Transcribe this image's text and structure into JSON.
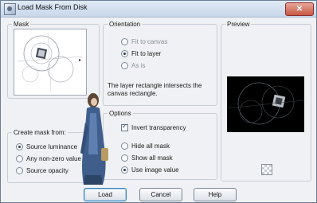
{
  "window": {
    "title": "Load Mask From Disk",
    "close_glyph": "✕"
  },
  "mask": {
    "group_label": "Mask",
    "thumbnail_icon": "mask-pattern-thumbnail",
    "dropdown_glyph": "▸"
  },
  "create_mask": {
    "group_label": "Create mask from:",
    "options": [
      {
        "label": "Source luminance",
        "selected": true
      },
      {
        "label": "Any non-zero value",
        "selected": false
      },
      {
        "label": "Source opacity",
        "selected": false
      }
    ]
  },
  "orientation": {
    "group_label": "Orientation",
    "options": [
      {
        "label": "Fit to canvas",
        "selected": false,
        "enabled": false
      },
      {
        "label": "Fit to layer",
        "selected": true,
        "enabled": true
      },
      {
        "label": "As is",
        "selected": false,
        "enabled": false
      }
    ],
    "description": "The layer rectangle intersects the canvas rectangle."
  },
  "options": {
    "group_label": "Options",
    "invert_transparency": {
      "label": "Invert transparency",
      "checked": true
    },
    "radios": [
      {
        "label": "Hide all mask",
        "selected": false
      },
      {
        "label": "Show all mask",
        "selected": false
      },
      {
        "label": "Use image value",
        "selected": true
      }
    ]
  },
  "preview": {
    "group_label": "Preview",
    "zoom_icon": "checkerboard-icon"
  },
  "buttons": {
    "load": "Load",
    "cancel": "Cancel",
    "help": "Help"
  },
  "decor": {
    "figure_icon": "tube-lady-figure"
  }
}
